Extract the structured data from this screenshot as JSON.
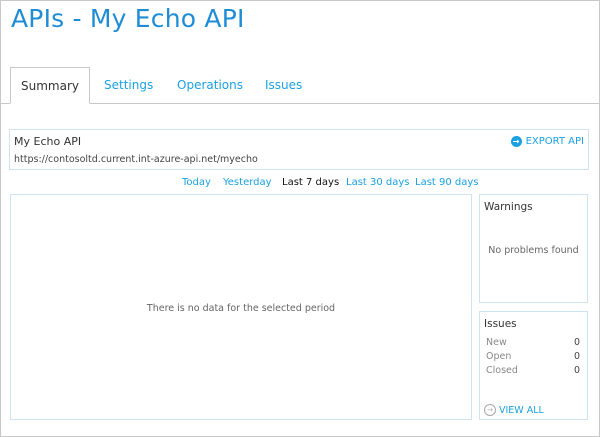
{
  "page": {
    "title": "APIs - My Echo API"
  },
  "tabs": [
    {
      "label": "Summary"
    },
    {
      "label": "Settings"
    },
    {
      "label": "Operations"
    },
    {
      "label": "Issues"
    }
  ],
  "api": {
    "name": "My Echo API",
    "url": "https://contosoltd.current.int-azure-api.net/myecho",
    "export_label": "EXPORT API"
  },
  "periods": [
    {
      "label": "Today"
    },
    {
      "label": "Yesterday"
    },
    {
      "label": "Last 7 days"
    },
    {
      "label": "Last 30 days"
    },
    {
      "label": "Last 90 days"
    }
  ],
  "chart": {
    "empty_message": "There is no data for the selected period"
  },
  "warnings": {
    "title": "Warnings",
    "message": "No problems found"
  },
  "issues": {
    "title": "Issues",
    "rows": [
      {
        "label": "New",
        "value": "0"
      },
      {
        "label": "Open",
        "value": "0"
      },
      {
        "label": "Closed",
        "value": "0"
      }
    ],
    "view_all_label": "VIEW ALL"
  },
  "colors": {
    "accent": "#1ba1e2",
    "title": "#1f8dd6",
    "box_border": "#cfe3f1"
  },
  "active_tab": "Summary",
  "active_period": "Last 7 days"
}
